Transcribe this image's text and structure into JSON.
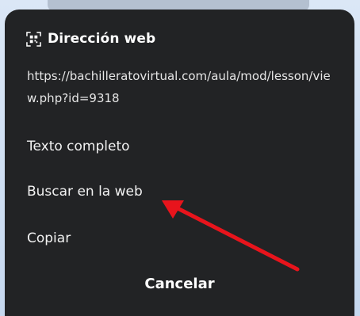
{
  "dialog": {
    "icon": "qr-scan-icon",
    "title": "Dirección web",
    "url": "https://bachilleratovirtual.com/aula/mod/lesson/view.php?id=9318"
  },
  "menu": {
    "items": [
      {
        "label": "Texto completo"
      },
      {
        "label": "Buscar en la web"
      },
      {
        "label": "Copiar"
      }
    ],
    "cancel_label": "Cancelar"
  },
  "annotation": {
    "type": "arrow",
    "color": "#e8141c",
    "points_to": "Buscar en la web"
  },
  "colors": {
    "sheet_bg": "#222325",
    "text": "#f1f1f1",
    "backdrop": "#cfe0f4"
  }
}
